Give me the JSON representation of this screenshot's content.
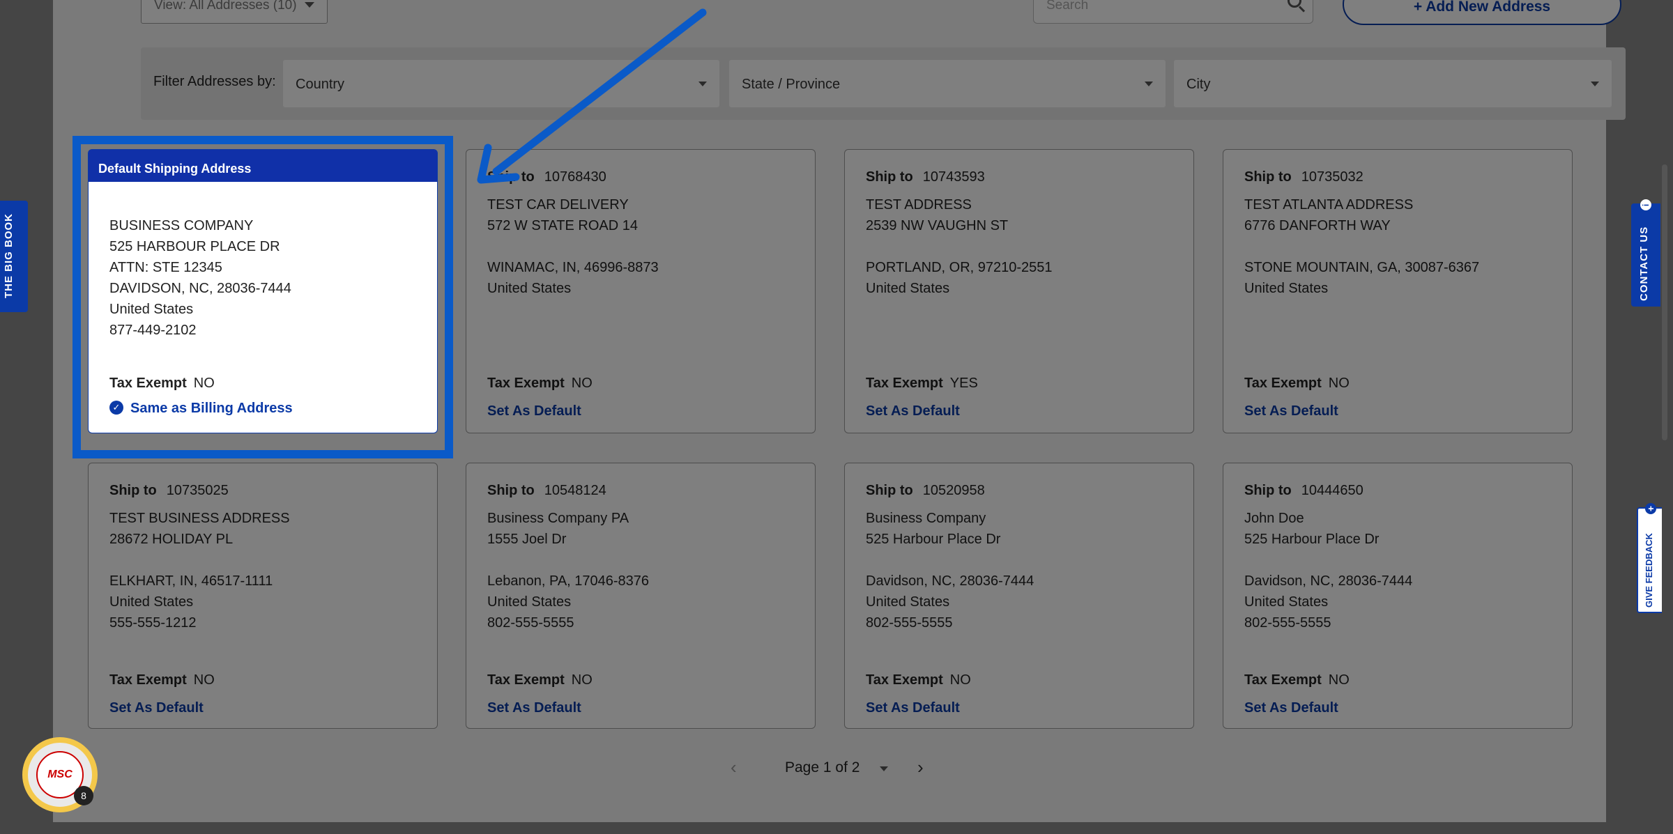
{
  "toolbar": {
    "view_label": "View: All Addresses (10)",
    "search_placeholder": "Search",
    "add_button": "+ Add New Address"
  },
  "filters": {
    "label": "Filter Addresses by:",
    "country": "Country",
    "state": "State / Province",
    "city": "City"
  },
  "default_card": {
    "header": "Default Shipping Address",
    "lines": [
      "BUSINESS COMPANY",
      "525 HARBOUR PLACE DR",
      "ATTN: STE 12345",
      "DAVIDSON, NC, 28036-7444",
      "United States",
      "877-449-2102"
    ],
    "tax_label": "Tax Exempt",
    "tax_value": "NO",
    "same_billing": "Same as Billing Address"
  },
  "ship_label": "Ship to",
  "tax_label": "Tax Exempt",
  "set_default_label": "Set As Default",
  "addresses": [
    {
      "id": "10768430",
      "lines": [
        "TEST CAR DELIVERY",
        "572 W STATE ROAD 14",
        "",
        "WINAMAC, IN, 46996-8873",
        "United States"
      ],
      "tax": "NO"
    },
    {
      "id": "10743593",
      "lines": [
        "TEST ADDRESS",
        "2539 NW VAUGHN ST",
        "",
        "PORTLAND, OR, 97210-2551",
        "United States"
      ],
      "tax": "YES"
    },
    {
      "id": "10735032",
      "lines": [
        "TEST ATLANTA ADDRESS",
        "6776 DANFORTH WAY",
        "",
        "STONE MOUNTAIN, GA, 30087-6367",
        "United States"
      ],
      "tax": "NO"
    },
    {
      "id": "10735025",
      "lines": [
        "TEST BUSINESS ADDRESS",
        "28672 HOLIDAY PL",
        "",
        "ELKHART, IN, 46517-1111",
        "United States",
        "555-555-1212"
      ],
      "tax": "NO"
    },
    {
      "id": "10548124",
      "lines": [
        "Business Company PA",
        "1555 Joel Dr",
        "",
        "Lebanon, PA, 17046-8376",
        "United States",
        "802-555-5555"
      ],
      "tax": "NO"
    },
    {
      "id": "10520958",
      "lines": [
        "Business Company",
        "525 Harbour Place Dr",
        "",
        "Davidson, NC, 28036-7444",
        "United States",
        "802-555-5555"
      ],
      "tax": "NO"
    },
    {
      "id": "10444650",
      "lines": [
        "John Doe",
        "525 Harbour Place Dr",
        "",
        "Davidson, NC, 28036-7444",
        "United States",
        "802-555-5555"
      ],
      "tax": "NO"
    }
  ],
  "pager": {
    "label": "Page 1 of 2"
  },
  "side_tabs": {
    "big_book": "THE BIG BOOK",
    "contact": "CONTACT US",
    "feedback": "GIVE FEEDBACK"
  },
  "badge": {
    "logo": "MSC",
    "count": "8"
  },
  "colors": {
    "brand_blue": "#0b3aa7",
    "highlight": "#0a5ac8"
  },
  "icons": [
    "chevron-down-icon",
    "search-icon",
    "check-circle-icon",
    "chevron-left-icon",
    "chevron-right-icon",
    "info-icon",
    "plus-circle-icon",
    "arrow-annotation"
  ]
}
